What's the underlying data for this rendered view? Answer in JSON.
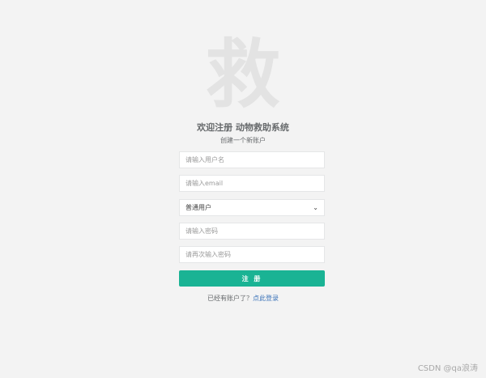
{
  "logo": {
    "char": "救"
  },
  "header": {
    "title": "欢迎注册 动物救助系统",
    "subtitle": "创建一个新账户"
  },
  "form": {
    "username_placeholder": "请输入用户名",
    "email_placeholder": "请输入email",
    "role_selected": "普通用户",
    "password_placeholder": "请输入密码",
    "password_confirm_placeholder": "请再次输入密码",
    "submit_label": "注 册"
  },
  "footer": {
    "login_prompt": "已经有账户了？",
    "login_link": "点此登录"
  },
  "watermark": "CSDN @qa浪涛"
}
